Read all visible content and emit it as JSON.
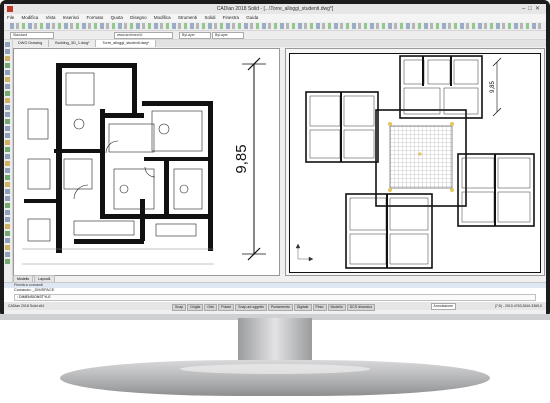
{
  "window": {
    "title": "CADian 2018 Solid - [...\\Torre_alloggi_studenti.dwg*]",
    "app_icon": "cadian-logo-icon",
    "controls": [
      "minimize-icon",
      "maximize-icon",
      "close-icon"
    ]
  },
  "menubar": {
    "items": [
      "File",
      "Modifica",
      "Vista",
      "Inserisci",
      "Formato",
      "Quota",
      "Disegno",
      "Modifica",
      "Strumenti",
      "Solidi",
      "Finestra",
      "Guida"
    ]
  },
  "toolbar": {
    "layer_combo": "Standard",
    "style_combo": "www.archinect.it",
    "linetype_combo": "ByLayer",
    "color_combo": "ByLayer"
  },
  "document_tabs": [
    "DWG Drawing",
    "Building_3D_1.dwg*",
    "Torre_alloggi_studenti.dwg*"
  ],
  "drawing": {
    "dimension_value": "9,85",
    "dimension_value_small": "9,85"
  },
  "layout_tabs": [
    "Modello",
    "Layout1"
  ],
  "command_panel": {
    "header": "Finestra comandi",
    "history": "Comando: _DIMSPACE",
    "prompt": ": DIMENSIONSTYLE"
  },
  "statusbar": {
    "left_text": "CADian 2018 Solid x64",
    "buttons": [
      "Snap",
      "Griglia",
      "Orto",
      "Polare",
      "Snap ad oggetto",
      "Puntamento",
      "Digitale",
      "Peso",
      "Modello",
      "DCS dinamico"
    ],
    "annotation_scale": "Annotazione",
    "coords": "(7:5) - 2010.4763,3616.3365,0"
  }
}
